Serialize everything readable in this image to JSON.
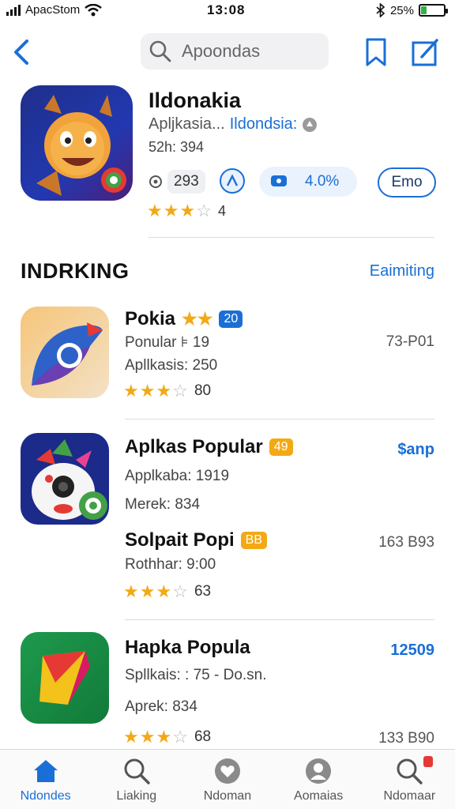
{
  "status": {
    "carrier": "ApacStom",
    "time": "13:08",
    "battery_text": "25%",
    "battery_level": 0.25
  },
  "nav": {
    "search_text": "Apoondas"
  },
  "app": {
    "title": "Ildonakia",
    "subtitle_prefix": "Apljkasia...",
    "subtitle_dev": "Ildondsia:",
    "meta": "52h: 394",
    "count": "293",
    "percent": "4.0%",
    "get_label": "Emo",
    "rating_stars": 3,
    "rating_count": "4"
  },
  "section": {
    "title": "INDRKING",
    "link": "Eaimiting"
  },
  "rows": [
    {
      "name": "Pokia",
      "badge": "20",
      "badge_color": "blue",
      "line1": "Ponular  ⊧ 19",
      "line2": "Apllkasis: 250",
      "right": "73-P01",
      "right_style": "gray",
      "stars": 3,
      "rating": "80"
    },
    {
      "name": "Aplkas Popular",
      "badge": "49",
      "badge_color": "orange",
      "line1": "Applkaba: 1919",
      "line2": "Merek: 834",
      "right": "$anp",
      "right_style": "blue"
    },
    {
      "name": "Solpait Popi",
      "badge": "BB",
      "badge_color": "orange",
      "line1": "Rothhar: 9:00",
      "right": "163 B93",
      "right_style": "gray",
      "stars": 3,
      "rating": "63"
    },
    {
      "name": "Hapka Popula",
      "line1": "Spllkais: : 75 - Do.sn.",
      "line2": "Aprek: 834",
      "right": "12509",
      "right_style": "blue",
      "right2": "133 B90",
      "stars": 3,
      "rating": "68"
    }
  ],
  "tabs": [
    {
      "label": "Ndondes",
      "icon": "home-icon",
      "active": true
    },
    {
      "label": "Liaking",
      "icon": "search-icon"
    },
    {
      "label": "Ndoman",
      "icon": "heart-icon"
    },
    {
      "label": "Aomaias",
      "icon": "person-icon"
    },
    {
      "label": "Ndomaar",
      "icon": "search-icon"
    }
  ],
  "colors": {
    "accent": "#1a6fd6",
    "star": "#f3a915",
    "badge_orange": "#f3a915"
  }
}
